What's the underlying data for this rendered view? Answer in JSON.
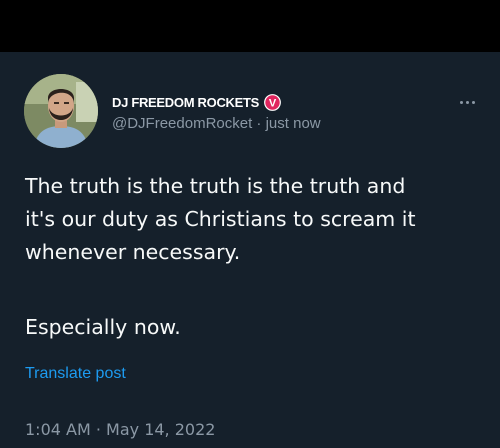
{
  "tweet": {
    "display_name": "DJ FREEDOM ROCKETS",
    "handle_line": "@DJFreedomRocket · just now",
    "text_line1": "The truth is the truth is the truth and",
    "text_line2": "it's our duty as Christians to scream it",
    "text_line3": "whenever necessary.",
    "text_line4": "Especially now.",
    "translate_label": "Translate post",
    "timestamp": "1:04 AM · May 14, 2022"
  },
  "badge": {
    "letter": "V",
    "color": "#e0245e"
  },
  "icons": {
    "more": "more-horizontal-icon",
    "badge": "verified-badge-icon",
    "avatar": "profile-avatar"
  },
  "colors": {
    "background": "#15202b",
    "top_bar": "#000000",
    "text": "#f7f9f9",
    "secondary_text": "#8b98a5",
    "link": "#1d9bf0"
  }
}
